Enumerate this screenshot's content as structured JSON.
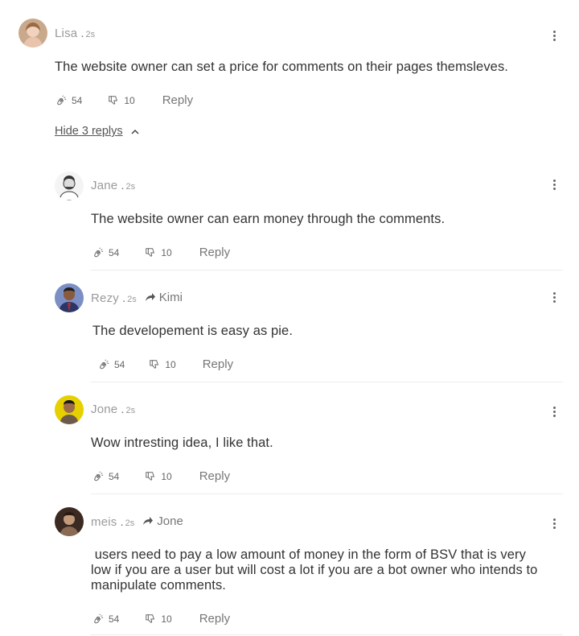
{
  "comment": {
    "author": "Lisa",
    "time": "2s",
    "text": "The website owner can set a price for comments on their pages themsleves.",
    "likes": "54",
    "dislikes": "10",
    "reply_label": "Reply",
    "hide_replies_label": "Hide 3 replys"
  },
  "replies": [
    {
      "author": "Jane",
      "time": "2s",
      "reply_to": "",
      "text": "The website owner can earn money through the comments.",
      "likes": "54",
      "dislikes": "10",
      "reply_label": "Reply"
    },
    {
      "author": "Rezy",
      "time": "2s",
      "reply_to": "Kimi",
      "text": "The developement is easy as pie.",
      "likes": "54",
      "dislikes": "10",
      "reply_label": "Reply"
    },
    {
      "author": "Jone",
      "time": "2s",
      "reply_to": "",
      "text": "Wow intresting idea, I like that.",
      "likes": "54",
      "dislikes": "10",
      "reply_label": "Reply"
    },
    {
      "author": "meis",
      "time": "2s",
      "reply_to": "Jone",
      "text": " users need to pay a low amount of money in the form of BSV that is very low if you are a user but will cost a lot if you are a bot owner who intends to manipulate comments.",
      "likes": "54",
      "dislikes": "10",
      "reply_label": "Reply"
    }
  ],
  "separator": ".",
  "icons": {
    "like": "clap-icon",
    "dislike": "thumbs-down-icon",
    "more": "more-vertical-icon",
    "reply_to": "reply-arrow-icon",
    "collapse": "chevron-up-icon"
  },
  "colors": {
    "text": "#333333",
    "meta": "#9a9a9a",
    "divider": "#ececec"
  }
}
